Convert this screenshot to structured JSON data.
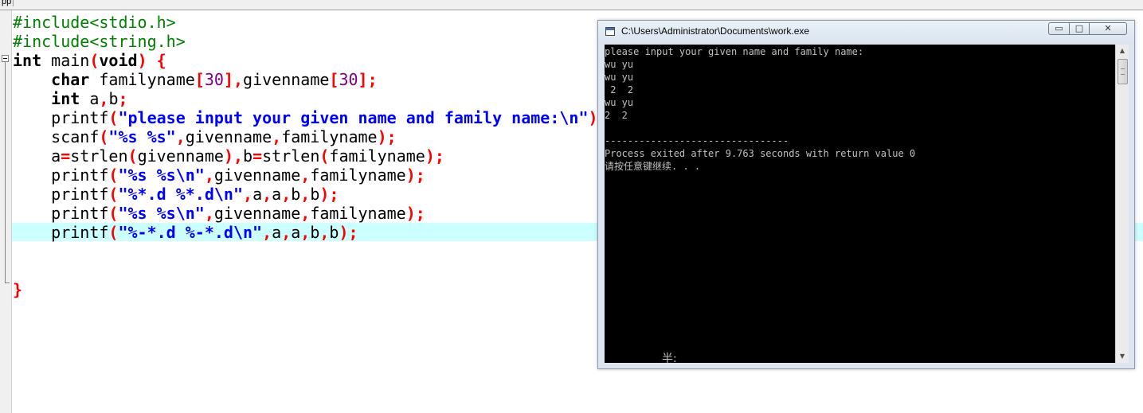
{
  "editor": {
    "tab_label": "pp",
    "lines": [
      {
        "t": [
          [
            "pp",
            "#include<stdio.h>"
          ]
        ]
      },
      {
        "t": [
          [
            "pp",
            "#include<string.h>"
          ]
        ]
      },
      {
        "t": [
          [
            "kw",
            "int"
          ],
          [
            "id",
            " main"
          ],
          [
            "sym",
            "("
          ],
          [
            "kw",
            "void"
          ],
          [
            "sym",
            ")"
          ],
          [
            "id",
            " "
          ],
          [
            "sym",
            "{"
          ]
        ]
      },
      {
        "t": [
          [
            "id",
            "    "
          ],
          [
            "kw",
            "char"
          ],
          [
            "id",
            " familyname"
          ],
          [
            "sym",
            "["
          ],
          [
            "num",
            "30"
          ],
          [
            "sym",
            "],"
          ],
          [
            "id",
            "givenname"
          ],
          [
            "sym",
            "["
          ],
          [
            "num",
            "30"
          ],
          [
            "sym",
            "];"
          ]
        ]
      },
      {
        "t": [
          [
            "id",
            "    "
          ],
          [
            "kw",
            "int"
          ],
          [
            "id",
            " a"
          ],
          [
            "sym",
            ","
          ],
          [
            "id",
            "b"
          ],
          [
            "sym",
            ";"
          ]
        ]
      },
      {
        "t": [
          [
            "id",
            "    printf"
          ],
          [
            "sym",
            "("
          ],
          [
            "str",
            "\"please input your given name and family name:\\n\""
          ],
          [
            "sym",
            ")"
          ]
        ]
      },
      {
        "t": [
          [
            "id",
            "    scanf"
          ],
          [
            "sym",
            "("
          ],
          [
            "str",
            "\"%s %s\""
          ],
          [
            "sym",
            ","
          ],
          [
            "id",
            "givenname"
          ],
          [
            "sym",
            ","
          ],
          [
            "id",
            "familyname"
          ],
          [
            "sym",
            ");"
          ]
        ]
      },
      {
        "t": [
          [
            "id",
            "    a"
          ],
          [
            "sym",
            "="
          ],
          [
            "id",
            "strlen"
          ],
          [
            "sym",
            "("
          ],
          [
            "id",
            "givenname"
          ],
          [
            "sym",
            "),"
          ],
          [
            "id",
            "b"
          ],
          [
            "sym",
            "="
          ],
          [
            "id",
            "strlen"
          ],
          [
            "sym",
            "("
          ],
          [
            "id",
            "familyname"
          ],
          [
            "sym",
            ");"
          ]
        ]
      },
      {
        "t": [
          [
            "id",
            "    printf"
          ],
          [
            "sym",
            "("
          ],
          [
            "str",
            "\"%s %s\\n\""
          ],
          [
            "sym",
            ","
          ],
          [
            "id",
            "givenname"
          ],
          [
            "sym",
            ","
          ],
          [
            "id",
            "familyname"
          ],
          [
            "sym",
            ");"
          ]
        ]
      },
      {
        "t": [
          [
            "id",
            "    printf"
          ],
          [
            "sym",
            "("
          ],
          [
            "str",
            "\"%*.d %*.d\\n\""
          ],
          [
            "sym",
            ","
          ],
          [
            "id",
            "a"
          ],
          [
            "sym",
            ","
          ],
          [
            "id",
            "a"
          ],
          [
            "sym",
            ","
          ],
          [
            "id",
            "b"
          ],
          [
            "sym",
            ","
          ],
          [
            "id",
            "b"
          ],
          [
            "sym",
            ");"
          ]
        ]
      },
      {
        "t": [
          [
            "id",
            "    printf"
          ],
          [
            "sym",
            "("
          ],
          [
            "str",
            "\"%s %s\\n\""
          ],
          [
            "sym",
            ","
          ],
          [
            "id",
            "givenname"
          ],
          [
            "sym",
            ","
          ],
          [
            "id",
            "familyname"
          ],
          [
            "sym",
            ");"
          ]
        ]
      },
      {
        "t": [
          [
            "id",
            "    printf"
          ],
          [
            "sym",
            "("
          ],
          [
            "str",
            "\"%-*.d %-*.d\\n\""
          ],
          [
            "sym",
            ","
          ],
          [
            "id",
            "a"
          ],
          [
            "sym",
            ","
          ],
          [
            "id",
            "a"
          ],
          [
            "sym",
            ","
          ],
          [
            "id",
            "b"
          ],
          [
            "sym",
            ","
          ],
          [
            "id",
            "b"
          ],
          [
            "sym",
            ");"
          ]
        ]
      },
      {
        "t": []
      },
      {
        "t": []
      },
      {
        "t": [
          [
            "sym",
            "}"
          ]
        ]
      }
    ]
  },
  "console": {
    "title": "C:\\Users\\Administrator\\Documents\\work.exe",
    "btn_min": "▭",
    "btn_max": "□",
    "btn_close": "✕",
    "lines": [
      "please input your given name and family name:",
      "wu yu",
      "wu yu",
      " 2  2",
      "wu yu",
      "2  2",
      "",
      "--------------------------------",
      "Process exited after 9.763 seconds with return value 0",
      "请按任意键继续. . ."
    ],
    "ime_text": "半:",
    "scroll_up": "▲",
    "scroll_down": "▼"
  }
}
